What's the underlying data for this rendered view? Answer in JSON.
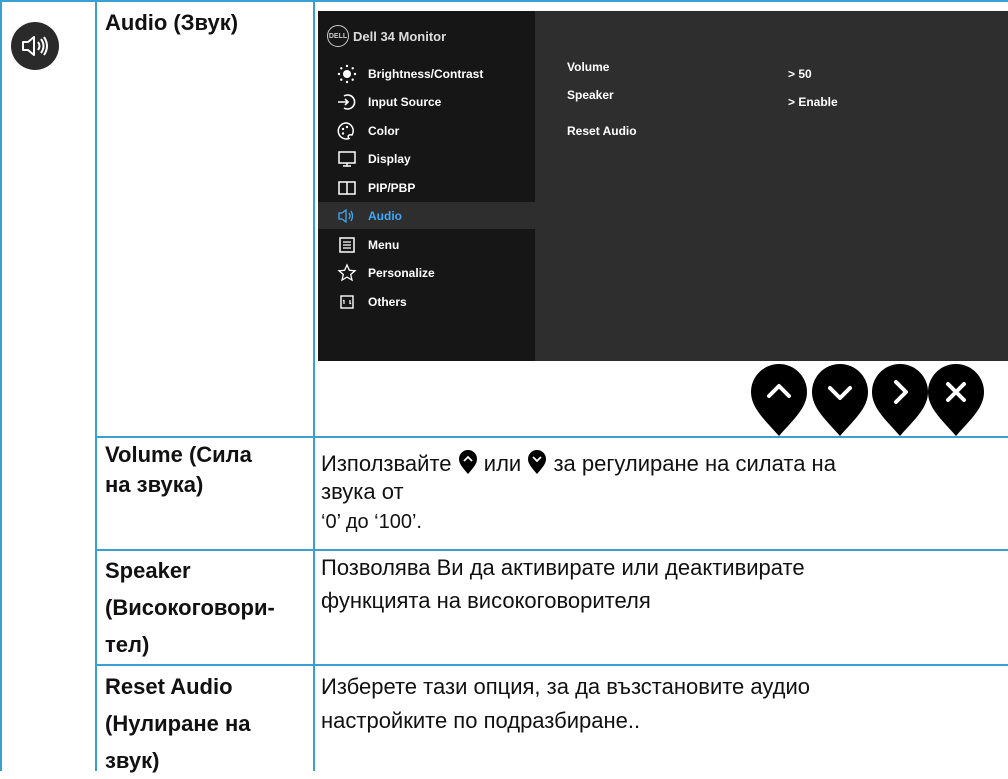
{
  "section": {
    "icon": "speaker-icon",
    "title": "Audio (Звук)"
  },
  "osd": {
    "logo_text": "DELL",
    "monitor_name": "Dell 34 Monitor",
    "menu": [
      {
        "label": "Brightness/Contrast",
        "icon": "brightness-icon"
      },
      {
        "label": "Input Source",
        "icon": "input-source-icon"
      },
      {
        "label": "Color",
        "icon": "color-palette-icon"
      },
      {
        "label": "Display",
        "icon": "display-icon"
      },
      {
        "label": "PIP/PBP",
        "icon": "pip-pbp-icon"
      },
      {
        "label": "Audio",
        "icon": "speaker-icon",
        "active": true
      },
      {
        "label": "Menu",
        "icon": "menu-icon"
      },
      {
        "label": "Personalize",
        "icon": "star-icon"
      },
      {
        "label": "Others",
        "icon": "others-icon"
      }
    ],
    "submenu": [
      {
        "label": "Volume",
        "value": "> 50"
      },
      {
        "label": "Speaker",
        "value": "> Enable"
      },
      {
        "label": "Reset Audio",
        "value": ""
      }
    ],
    "buttons": [
      "up-button",
      "down-button",
      "right-button",
      "close-button"
    ],
    "active_color": "#3fa9f5"
  },
  "rows": [
    {
      "label_lines": [
        "Volume (Сила",
        "на звука)"
      ],
      "desc_parts": {
        "before": "Използвайте",
        "middle": "или",
        "after": "за регулиране на силата на"
      },
      "desc_lines": [
        "звука от",
        "‘0’ до ‘100’."
      ]
    },
    {
      "label_lines": [
        "Speaker",
        "(Високоговори-",
        "тел)"
      ],
      "desc_lines": [
        "Позволява Ви да активирате или деактивирате",
        "функцията на високоговорителя"
      ]
    },
    {
      "label_lines": [
        "Reset Audio",
        "(Нулиране на",
        "звук)"
      ],
      "desc_lines": [
        "Изберете тази опция, за да възстановите аудио",
        "настройките по подразбиране.."
      ]
    }
  ],
  "colors": {
    "grid": "#3aa0cf",
    "osd_bg": "#161616",
    "osd_panel": "#2e2e2e"
  }
}
